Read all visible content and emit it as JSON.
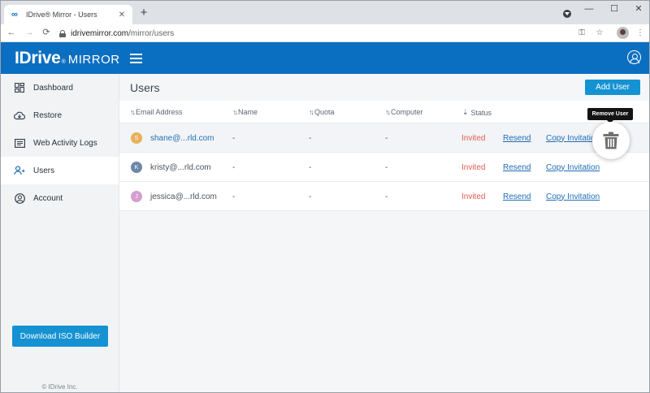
{
  "browser": {
    "tab_title": "IDrive® Mirror - Users",
    "url_host": "idrivemirror.com",
    "url_path": "/mirror/users",
    "new_tab": "+",
    "tab_close": "✕",
    "win_min": "—",
    "win_max": "☐",
    "win_close": "✕",
    "back": "←",
    "forward": "→",
    "reload": "⟳",
    "menu": "⋮"
  },
  "app": {
    "brand": "IDrive",
    "reg": "®",
    "product": "MIRROR",
    "colors": {
      "primary": "#0b6fc1",
      "button": "#1592d2",
      "invited": "#e45c4f",
      "link": "#1f6db5"
    }
  },
  "sidebar": {
    "items": [
      {
        "label": "Dashboard",
        "icon": "dashboard-icon",
        "active": false
      },
      {
        "label": "Restore",
        "icon": "cloud-restore-icon",
        "active": false
      },
      {
        "label": "Web Activity Logs",
        "icon": "logs-icon",
        "active": false
      },
      {
        "label": "Users",
        "icon": "users-icon",
        "active": true
      },
      {
        "label": "Account",
        "icon": "account-icon",
        "active": false
      }
    ],
    "download_button": "Download ISO Builder",
    "copyright": "© IDrive Inc."
  },
  "main": {
    "title": "Users",
    "add_user_button": "Add User",
    "columns": [
      "Email Address",
      "Name",
      "Quota",
      "Computer",
      "Status"
    ],
    "rows": [
      {
        "initial": "S",
        "avatar_color": "#e8b15a",
        "email": "shane@...rld.com",
        "name": "-",
        "quota": "-",
        "computer": "-",
        "status": "Invited",
        "resend": "Resend",
        "copy": "Copy Invitation"
      },
      {
        "initial": "K",
        "avatar_color": "#6c88a6",
        "email": "kristy@...rld.com",
        "name": "-",
        "quota": "-",
        "computer": "-",
        "status": "Invited",
        "resend": "Resend",
        "copy": "Copy Invitation"
      },
      {
        "initial": "J",
        "avatar_color": "#d59ed0",
        "email": "jessica@...rld.com",
        "name": "-",
        "quota": "-",
        "computer": "-",
        "status": "Invited",
        "resend": "Resend",
        "copy": "Copy Invitation"
      }
    ],
    "tooltip": "Remove User"
  }
}
